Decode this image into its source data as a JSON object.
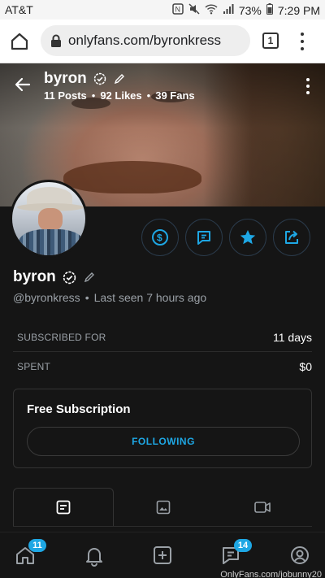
{
  "statusbar": {
    "carrier": "AT&T",
    "battery": "73%",
    "time": "7:29 PM",
    "icons": [
      "nfc-icon",
      "mute-icon",
      "wifi-icon",
      "signal-icon",
      "battery-icon"
    ]
  },
  "browser": {
    "url": "onlyfans.com/byronkress",
    "tab_count": "1"
  },
  "cover": {
    "name": "byron",
    "stats": {
      "posts": "11 Posts",
      "likes": "92 Likes",
      "fans": "39 Fans",
      "separator": "•"
    }
  },
  "profile": {
    "name": "byron",
    "handle": "@byronkress",
    "separator": "•",
    "last_seen": "Last seen 7 hours ago"
  },
  "info": {
    "subscribed_label": "SUBSCRIBED FOR",
    "subscribed_value": "11 days",
    "spent_label": "SPENT",
    "spent_value": "$0"
  },
  "subscription": {
    "title": "Free Subscription",
    "button": "FOLLOWING"
  },
  "tabs": [
    "posts-tab",
    "media-tab",
    "videos-tab"
  ],
  "nav": {
    "home_badge": "11",
    "messages_badge": "14"
  },
  "watermark": "OnlyFans.com/jobunny20",
  "colors": {
    "accent": "#1ea7e4",
    "background": "#151515",
    "muted_text": "#9aa0a6"
  }
}
